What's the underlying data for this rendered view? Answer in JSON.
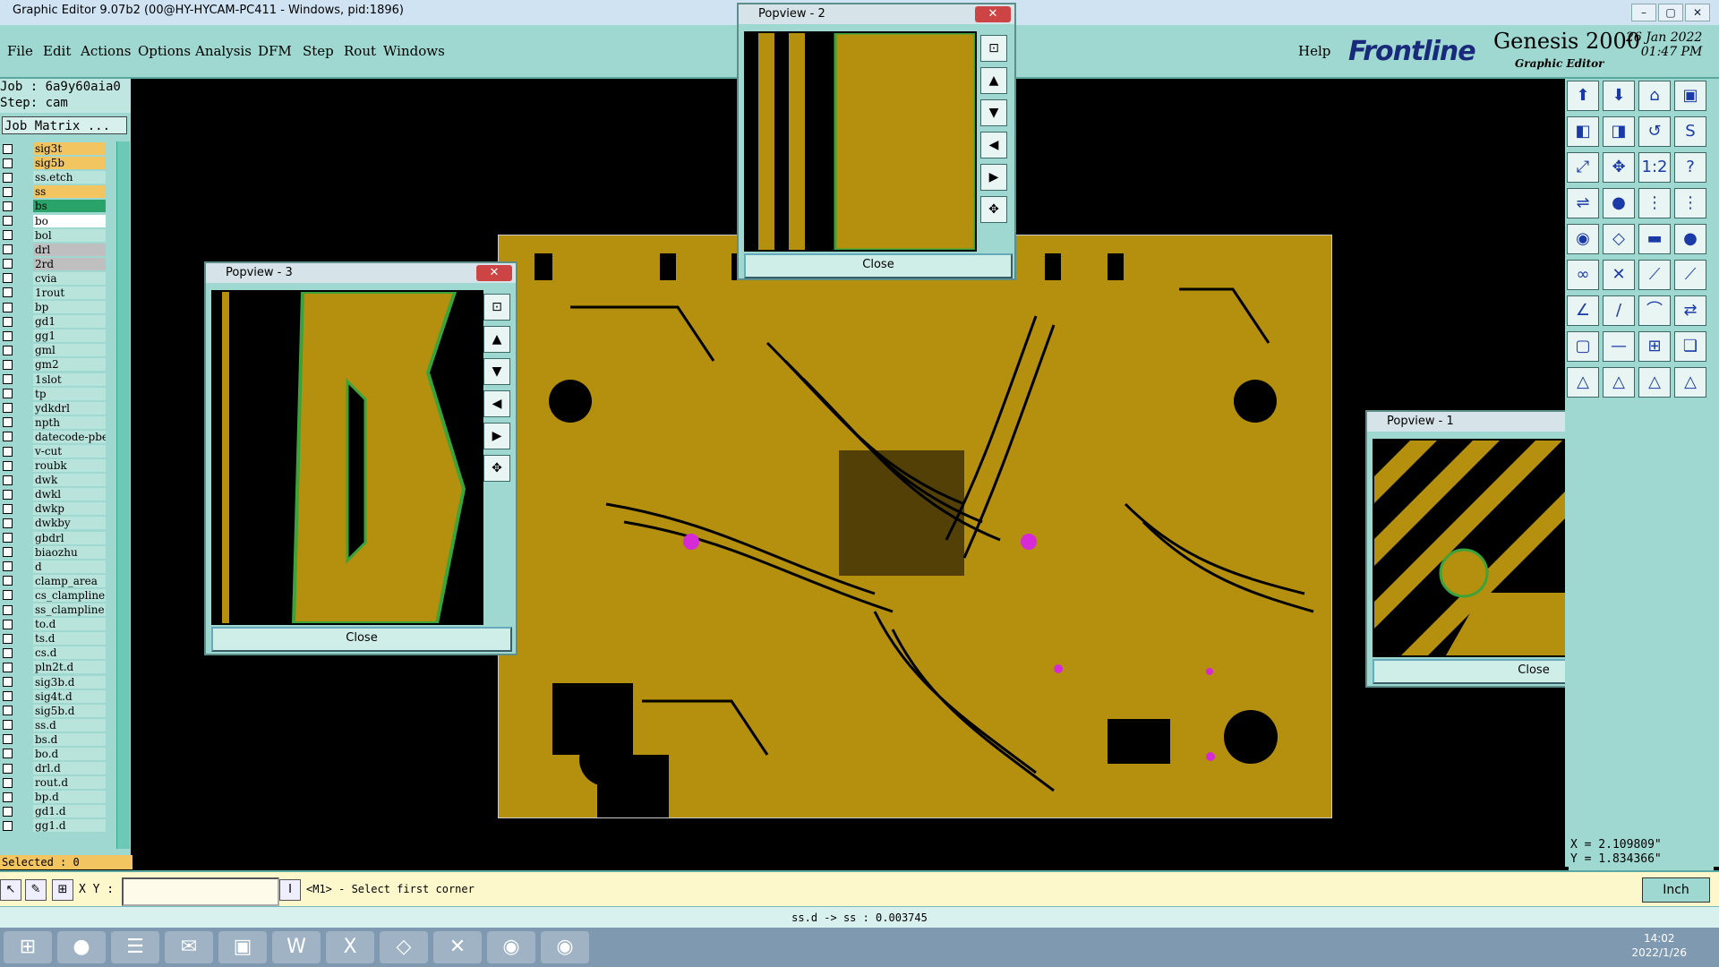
{
  "window": {
    "title": "Graphic Editor 9.07b2 (00@HY-HYCAM-PC411 - Windows, pid:1896)",
    "min": "–",
    "max": "▢",
    "close": "✕"
  },
  "menu": [
    "File",
    "Edit",
    "Actions",
    "Options",
    "Analysis",
    "DFM",
    "Step",
    "Rout",
    "Windows"
  ],
  "help_label": "Help",
  "brand": {
    "logo": "Frontline",
    "product": "Genesis 2000",
    "subtitle": "Graphic Editor",
    "date": "26 Jan 2022",
    "time": "01:47 PM"
  },
  "job": {
    "job_line": "Job : 6a9y60aia0",
    "step_line": "Step: cam",
    "matrix_button": "Job Matrix ..."
  },
  "layers": [
    {
      "name": "sig3t",
      "color": "#f2c560"
    },
    {
      "name": "sig5b",
      "color": "#f2c560"
    },
    {
      "name": "ss.etch",
      "color": ""
    },
    {
      "name": "ss",
      "color": "#f2c560"
    },
    {
      "name": "bs",
      "color": "#2aa36a"
    },
    {
      "name": "bo",
      "color": "#ffffff"
    },
    {
      "name": "bol",
      "color": ""
    },
    {
      "name": "drl",
      "color": "#bfbfbf"
    },
    {
      "name": "2rd",
      "color": "#bfbfbf"
    },
    {
      "name": "cvia",
      "color": ""
    },
    {
      "name": "1rout",
      "color": ""
    },
    {
      "name": "bp",
      "color": ""
    },
    {
      "name": "gd1",
      "color": ""
    },
    {
      "name": "gg1",
      "color": ""
    },
    {
      "name": "gml",
      "color": ""
    },
    {
      "name": "gm2",
      "color": ""
    },
    {
      "name": "1slot",
      "color": ""
    },
    {
      "name": "tp",
      "color": ""
    },
    {
      "name": "ydkdrl",
      "color": ""
    },
    {
      "name": "npth",
      "color": ""
    },
    {
      "name": "datecode-pbe",
      "color": ""
    },
    {
      "name": "v-cut",
      "color": ""
    },
    {
      "name": "roubk",
      "color": ""
    },
    {
      "name": "dwk",
      "color": ""
    },
    {
      "name": "dwkl",
      "color": ""
    },
    {
      "name": "dwkp",
      "color": ""
    },
    {
      "name": "dwkby",
      "color": ""
    },
    {
      "name": "gbdrl",
      "color": ""
    },
    {
      "name": "biaozhu",
      "color": ""
    },
    {
      "name": "d",
      "color": ""
    },
    {
      "name": "clamp_area",
      "color": ""
    },
    {
      "name": "cs_clampline",
      "color": ""
    },
    {
      "name": "ss_clampline",
      "color": ""
    },
    {
      "name": "to.d",
      "color": ""
    },
    {
      "name": "ts.d",
      "color": ""
    },
    {
      "name": "cs.d",
      "color": ""
    },
    {
      "name": "pln2t.d",
      "color": ""
    },
    {
      "name": "sig3b.d",
      "color": ""
    },
    {
      "name": "sig4t.d",
      "color": ""
    },
    {
      "name": "sig5b.d",
      "color": ""
    },
    {
      "name": "ss.d",
      "color": ""
    },
    {
      "name": "bs.d",
      "color": ""
    },
    {
      "name": "bo.d",
      "color": ""
    },
    {
      "name": "drl.d",
      "color": ""
    },
    {
      "name": "rout.d",
      "color": ""
    },
    {
      "name": "bp.d",
      "color": ""
    },
    {
      "name": "gd1.d",
      "color": ""
    },
    {
      "name": "gg1.d",
      "color": ""
    }
  ],
  "selected_label": "Selected : 0",
  "coords": {
    "x": "X = 2.109809\"",
    "y": "Y = 1.834366\""
  },
  "cmd": {
    "xy_label": "X Y :",
    "xy_value": "",
    "prompt": "<M1> - Select first corner",
    "unit": "Inch"
  },
  "status": "ss.d -> ss : 0.003745",
  "popups": [
    {
      "title": "Popview - 2",
      "close_button": "Close"
    },
    {
      "title": "Popview - 3",
      "close_button": "Close"
    },
    {
      "title": "Popview - 1",
      "close_button": "Close"
    }
  ],
  "taskbar": {
    "time": "14:02",
    "date": "2022/1/26"
  }
}
